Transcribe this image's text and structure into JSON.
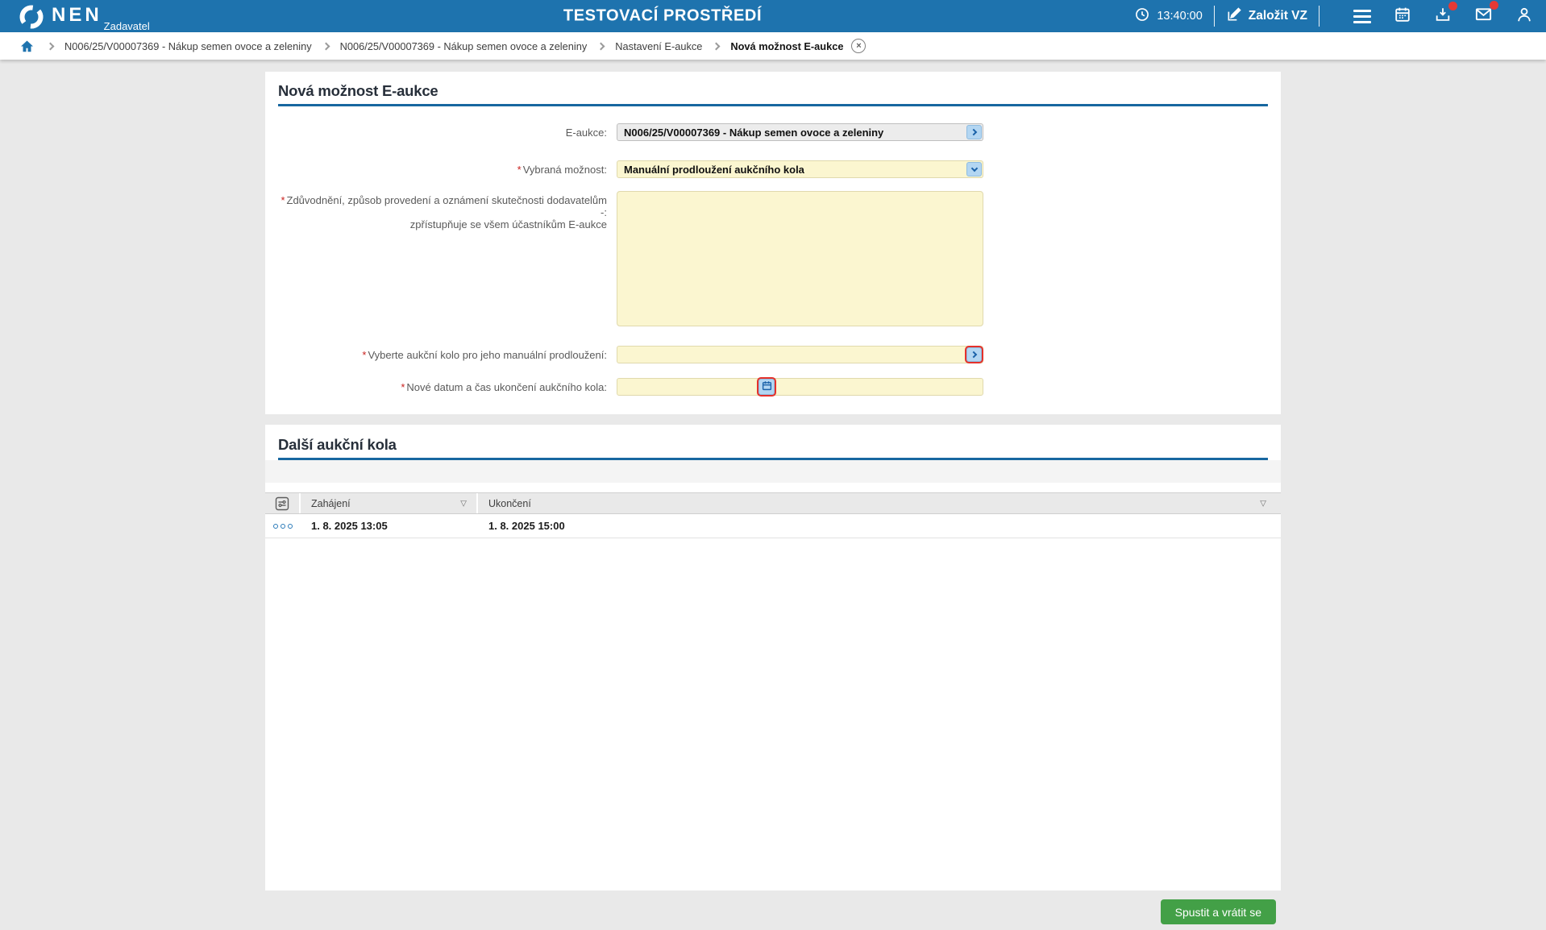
{
  "app": {
    "logo": "NEN",
    "logo_sub": "Zadavatel",
    "environment_title": "TESTOVACÍ PROSTŘEDÍ",
    "clock": "13:40:00",
    "create_vz_label": "Založit VZ"
  },
  "breadcrumb": {
    "items": [
      "N006/25/V00007369 - Nákup semen ovoce a zeleniny",
      "N006/25/V00007369 - Nákup semen ovoce a zeleniny",
      "Nastavení E-aukce",
      "Nová možnost E-aukce"
    ],
    "close_glyph": "×"
  },
  "form": {
    "title": "Nová možnost E-aukce",
    "required_marker": "*",
    "eaukce_label": "E-aukce:",
    "eaukce_value": "N006/25/V00007369 - Nákup semen ovoce a zeleniny",
    "option_label": "Vybraná možnost:",
    "option_value": "Manuální prodloužení aukčního kola",
    "justification_label_line1": "Zdůvodnění, způsob provedení a oznámení skutečnosti dodavatelům -:",
    "justification_label_line2": "zpřístupňuje se všem účastníkům E-aukce",
    "justification_value": "",
    "round_label": "Vyberte aukční kolo pro jeho manuální prodloužení:",
    "round_value": "",
    "new_end_label": "Nové datum a čas ukončení aukčního kola:",
    "new_end_value": ""
  },
  "rounds_table": {
    "title": "Další aukční kola",
    "columns": {
      "start": "Zahájení",
      "end": "Ukončení"
    },
    "sort_icon": "▽",
    "rows": [
      {
        "start": "1. 8. 2025 13:05",
        "end": "1. 8. 2025 15:00"
      }
    ]
  },
  "footer": {
    "submit_label": "Spustit a vrátit se"
  },
  "colors": {
    "header_blue": "#1e73ae",
    "section_rule_blue": "#1767a0",
    "field_yellow": "#fbf6d0",
    "button_green": "#43a047",
    "alert_red": "#e53935"
  }
}
